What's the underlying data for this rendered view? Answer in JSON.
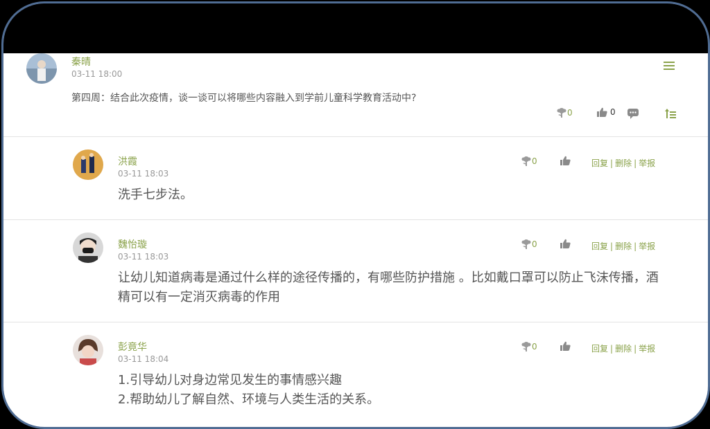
{
  "post": {
    "author": "秦晴",
    "time": "03-11 18:00",
    "content": "第四周：结合此次疫情，谈一谈可以将哪些内容融入到学前儿童科学教育活动中?",
    "flower_count": "0",
    "like_count": "0"
  },
  "replies": [
    {
      "author": "洪霞",
      "time": "03-11 18:03",
      "flower_count": "0",
      "lines": [
        "洗手七步法。"
      ]
    },
    {
      "author": "魏怡璇",
      "time": "03-11 18:03",
      "flower_count": "0",
      "lines": [
        "让幼儿知道病毒是通过什么样的途径传播的，有哪些防护措施 。比如戴口罩可以防止飞沫传播，酒",
        "精可以有一定消灭病毒的作用"
      ]
    },
    {
      "author": "彭竟华",
      "time": "03-11 18:04",
      "flower_count": "0",
      "lines": [
        "1.引导幼儿对身边常见发生的事情感兴趣",
        "2.帮助幼儿了解自然、环境与人类生活的关系。"
      ]
    }
  ],
  "actions": {
    "reply": "回复",
    "delete": "删除",
    "report": "举报",
    "sep": "|"
  },
  "icons": {
    "menu": "menu-icon",
    "flower": "flower-icon",
    "like": "thumbs-up-icon",
    "comment": "comment-icon",
    "pin": "pin-top-icon"
  },
  "colors": {
    "accent": "#8aa24a",
    "frame_border": "#4f6c93"
  }
}
